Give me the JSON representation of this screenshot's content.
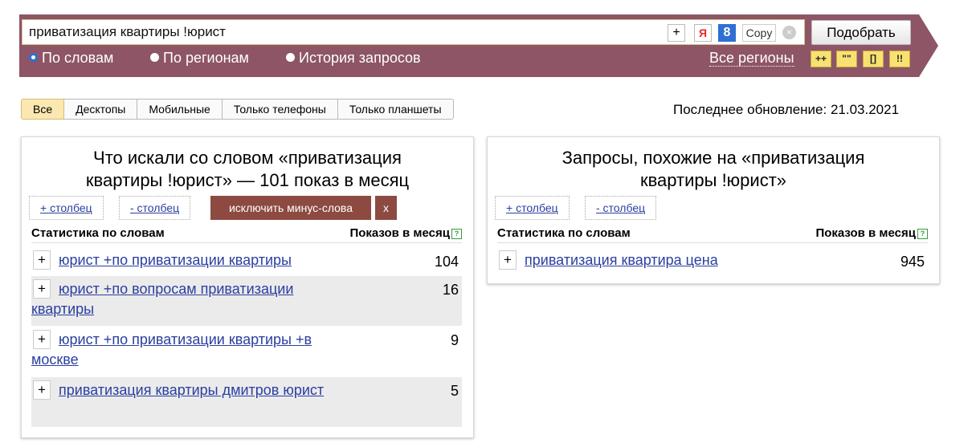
{
  "search": {
    "query": "приватизация квартиры !юрист",
    "plus": "+",
    "ya": "Я",
    "google": "8",
    "copy": "Copy",
    "clear": "×",
    "submit": "Подобрать"
  },
  "modes": [
    "По словам",
    "По регионам",
    "История запросов"
  ],
  "regions": "Все регионы",
  "operators": [
    "++",
    "\"\"",
    "[]",
    "!!"
  ],
  "tabs": [
    "Все",
    "Десктопы",
    "Мобильные",
    "Только телефоны",
    "Только планшеты"
  ],
  "updated": "Последнее обновление: 21.03.2021",
  "left": {
    "title": "Что искали со словом «приватизация квартиры !юрист» — 101 показ в месяц",
    "add_col": "+ столбец",
    "remove_col": "- столбец",
    "exclude": "исключить минус-слова",
    "x": "x",
    "col1": "Статистика по словам",
    "col2": "Показов в месяц",
    "rows": [
      {
        "text": "юрист +по приватизации квартиры",
        "count": "104"
      },
      {
        "text": "юрист +по вопросам приватизации квартиры",
        "count": "16"
      },
      {
        "text": "юрист +по приватизации квартиры +в москве",
        "count": "9"
      },
      {
        "text": "приватизация квартиры дмитров юрист",
        "count": "5"
      }
    ]
  },
  "right": {
    "title": "Запросы, похожие на «приватизация квартиры !юрист»",
    "add_col": "+ столбец",
    "remove_col": "- столбец",
    "col1": "Статистика по словам",
    "col2": "Показов в месяц",
    "rows": [
      {
        "text": "приватизация квартира цена",
        "count": "945"
      }
    ]
  },
  "colors": {
    "bar": "#8d5566",
    "active_tab": "#fbe7b0",
    "link": "#2a3fa0",
    "exclude": "#8d4a41"
  }
}
